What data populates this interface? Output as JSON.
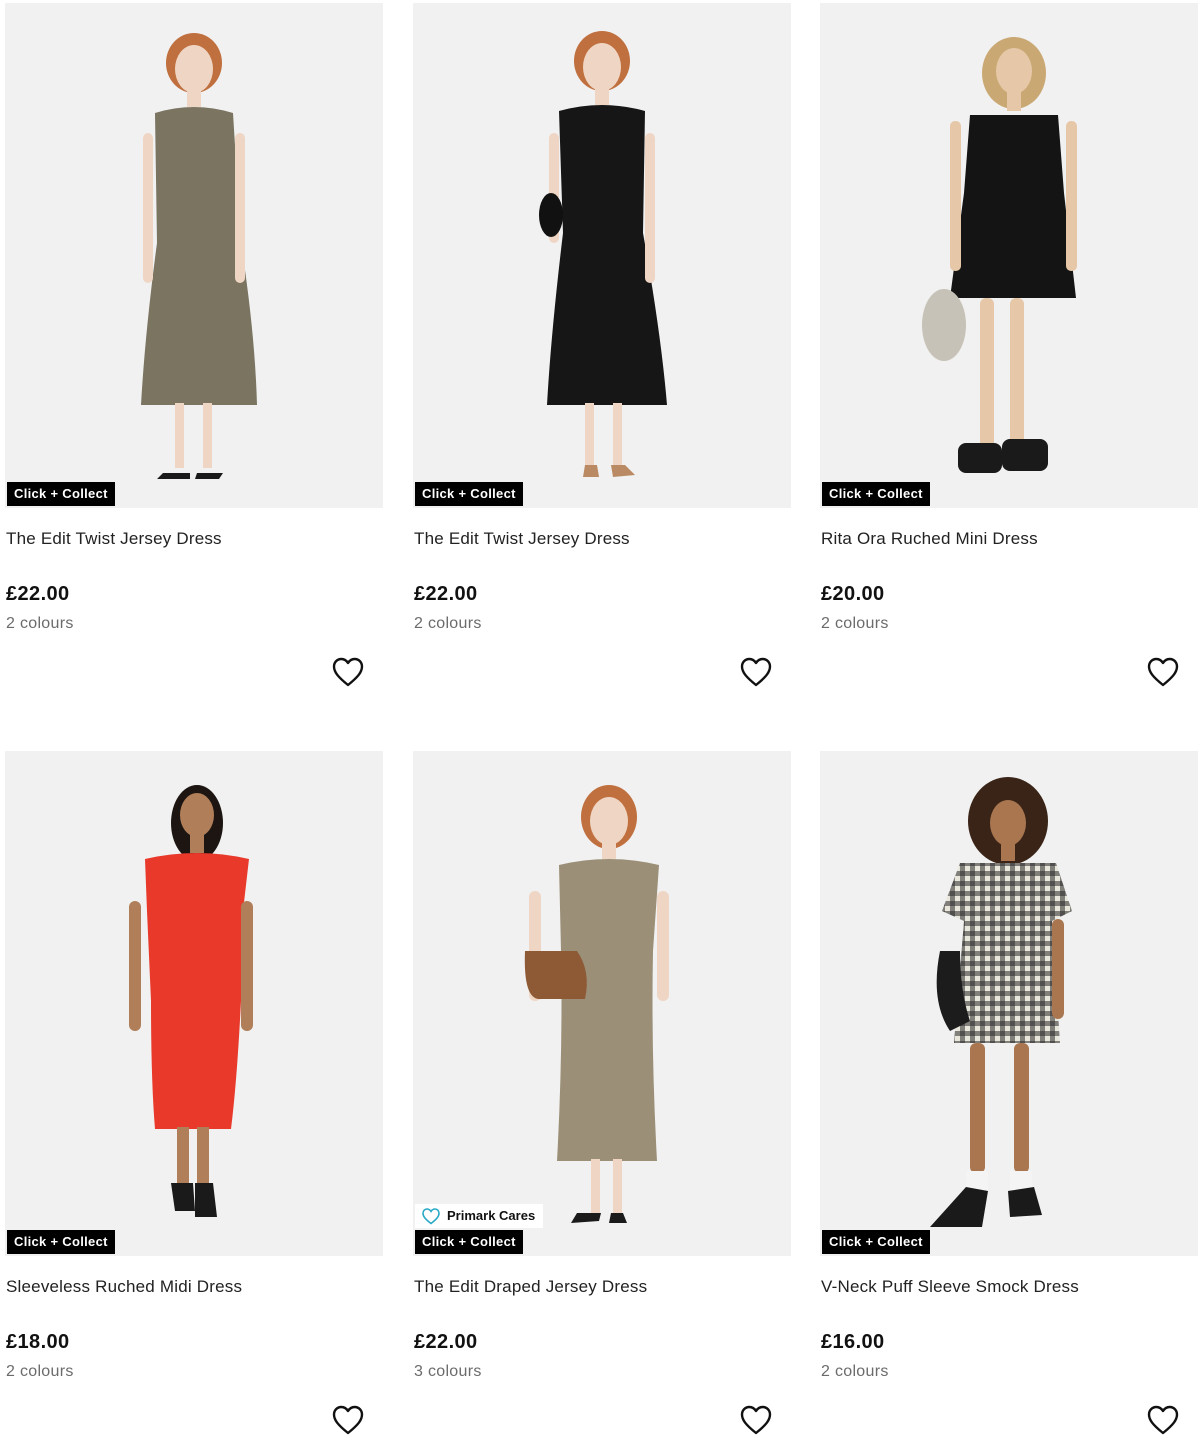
{
  "products": [
    {
      "name": "The Edit Twist Jersey Dress",
      "price": "£22.00",
      "colours": "2 colours",
      "badges": {
        "click_collect": "Click + Collect",
        "cares": ""
      },
      "dress_color": "#7a7461",
      "skin": "#efd6c4",
      "hair": "#c0703f"
    },
    {
      "name": "The Edit Twist Jersey Dress",
      "price": "£22.00",
      "colours": "2 colours",
      "badges": {
        "click_collect": "Click + Collect",
        "cares": ""
      },
      "dress_color": "#161616",
      "skin": "#efd6c4",
      "hair": "#c0703f"
    },
    {
      "name": "Rita Ora Ruched Mini Dress",
      "price": "£20.00",
      "colours": "2 colours",
      "badges": {
        "click_collect": "Click + Collect",
        "cares": ""
      },
      "dress_color": "#141414",
      "skin": "#e6c7a7",
      "hair": "#c9a873"
    },
    {
      "name": "Sleeveless Ruched Midi Dress",
      "price": "£18.00",
      "colours": "2 colours",
      "badges": {
        "click_collect": "Click + Collect",
        "cares": ""
      },
      "dress_color": "#e8392a",
      "skin": "#b07e58",
      "hair": "#1c1512"
    },
    {
      "name": "The Edit Draped Jersey Dress",
      "price": "£22.00",
      "colours": "3 colours",
      "badges": {
        "click_collect": "Click + Collect",
        "cares": "Primark Cares"
      },
      "dress_color": "#9b8f78",
      "skin": "#efd6c4",
      "hair": "#c0703f"
    },
    {
      "name": "V-Neck Puff Sleeve Smock Dress",
      "price": "£16.00",
      "colours": "2 colours",
      "badges": {
        "click_collect": "Click + Collect",
        "cares": ""
      },
      "dress_color": "#d9d6cc",
      "skin": "#a9764f",
      "hair": "#3a2418"
    }
  ],
  "icons": {
    "wishlist": "heart-outline-icon",
    "cares": "heart-outline-icon",
    "accent_cares": "#29a9c6"
  }
}
